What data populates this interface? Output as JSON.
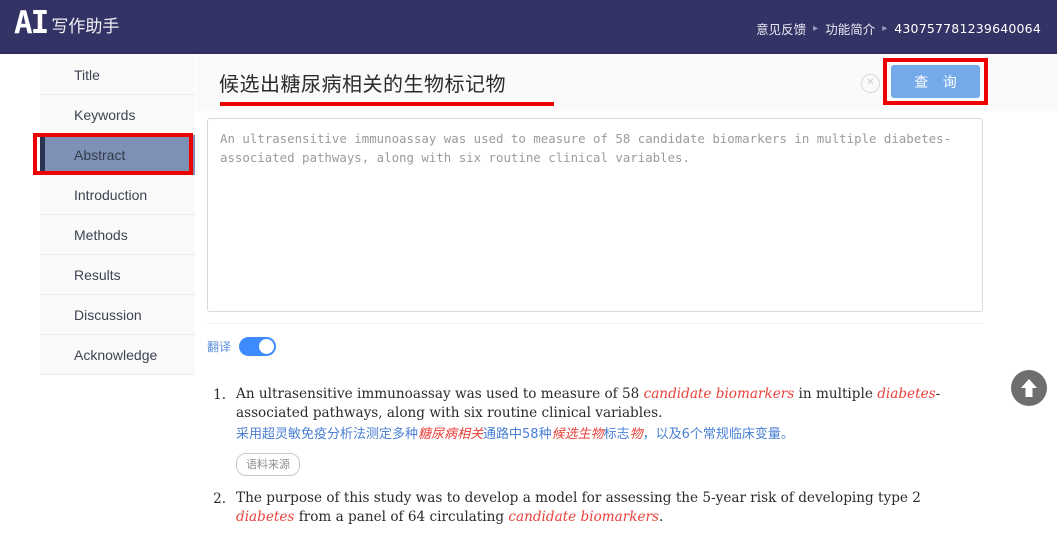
{
  "header": {
    "logo_mark": "AI",
    "logo_text": "写作助手",
    "nav": [
      {
        "label": "意见反馈",
        "icon": "feedback"
      },
      {
        "label": "功能简介",
        "icon": "info"
      }
    ],
    "separator": "▸",
    "user_id": "430757781239640064"
  },
  "sidebar": {
    "items": [
      {
        "label": "Title",
        "active": false
      },
      {
        "label": "Keywords",
        "active": false
      },
      {
        "label": "Abstract",
        "active": true
      },
      {
        "label": "Introduction",
        "active": false
      },
      {
        "label": "Methods",
        "active": false
      },
      {
        "label": "Results",
        "active": false
      },
      {
        "label": "Discussion",
        "active": false
      },
      {
        "label": "Acknowledge",
        "active": false
      }
    ]
  },
  "main": {
    "doc_title": "候选出糖尿病相关的生物标记物",
    "clear_icon": "circle-x-icon",
    "query_button": "查 询",
    "editor": {
      "value": "An ultrasensitive immunoassay was used to measure of 58 candidate biomarkers in multiple diabetes-associated pathways, along with six routine clinical variables.",
      "placeholder": ""
    },
    "translate": {
      "label": "翻译",
      "enabled": true
    },
    "results": [
      {
        "num": "1.",
        "en_parts": [
          {
            "t": "An ultrasensitive immunoassay was used to measure of 58 ",
            "hl": false
          },
          {
            "t": "candidate biomarkers",
            "hl": true
          },
          {
            "t": " in multiple ",
            "hl": false
          },
          {
            "t": "diabetes",
            "hl": true
          },
          {
            "t": "-associated pathways, along with six routine clinical variables.",
            "hl": false
          }
        ],
        "zh_parts": [
          {
            "t": "采用超灵敏免疫分析法测定多种",
            "hl": false
          },
          {
            "t": "糖尿病相关",
            "hl": true
          },
          {
            "t": "通路中58种",
            "hl": false
          },
          {
            "t": "候选生物",
            "hl": true
          },
          {
            "t": "标志",
            "hl": false
          },
          {
            "t": "物",
            "hl": true
          },
          {
            "t": "，以及6个常规临床变量。",
            "hl": false
          }
        ],
        "badge": "语料来源"
      },
      {
        "num": "2.",
        "en_parts": [
          {
            "t": "The purpose of this study was to develop a model for assessing the 5-year risk of developing type 2 ",
            "hl": false
          },
          {
            "t": "diabetes",
            "hl": true
          },
          {
            "t": " from a panel of 64 circulating ",
            "hl": false
          },
          {
            "t": "candidate biomarkers",
            "hl": true
          },
          {
            "t": ".",
            "hl": false
          }
        ],
        "zh_parts": [],
        "badge": ""
      }
    ]
  },
  "scroll_top": {
    "icon": "arrow-up-icon"
  },
  "colors": {
    "header_bg": "#333366",
    "accent_blue": "#74a9ea",
    "annotation_red": "#ef0000",
    "active_item_bg": "#7d90b5",
    "highlight_red": "#e8403a",
    "translation_blue": "#4a7fd4"
  }
}
